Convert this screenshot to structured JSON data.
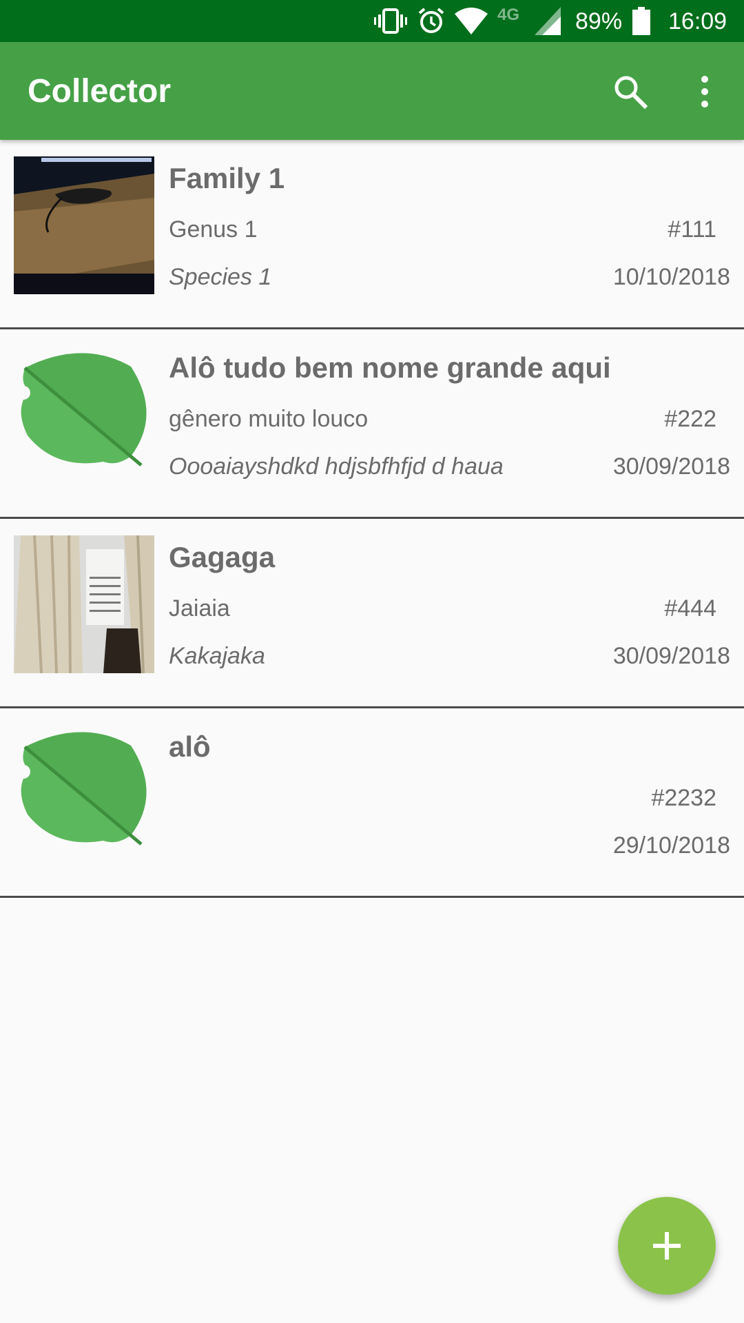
{
  "status_bar": {
    "network_type": "4G",
    "battery_percent": "89%",
    "time": "16:09",
    "icons": [
      "vibrate-icon",
      "alarm-icon",
      "wifi-icon",
      "signal-icon",
      "battery-icon"
    ]
  },
  "app_bar": {
    "title": "Collector",
    "icons": [
      "search-icon",
      "more-vert-icon"
    ]
  },
  "colors": {
    "status_bar": "#006e1b",
    "app_bar": "#46a146",
    "fab": "#8bc34a",
    "leaf": "#5cb85c"
  },
  "items": [
    {
      "thumbnail": "photo",
      "family": "Family 1",
      "genus": "Genus 1",
      "species": "Species 1",
      "number": "#111",
      "date": "10/10/2018"
    },
    {
      "thumbnail": "leaf-icon",
      "family": "Alô tudo bem nome grande aqui",
      "genus": "gênero muito louco",
      "species": "Oooaiayshdkd hdjsbfhfjd d haua",
      "number": "#222",
      "date": "30/09/2018"
    },
    {
      "thumbnail": "photo",
      "family": "Gagaga",
      "genus": "Jaiaia",
      "species": "Kakajaka",
      "number": "#444",
      "date": "30/09/2018"
    },
    {
      "thumbnail": "leaf-icon",
      "family": "alô",
      "genus": "",
      "species": "",
      "number": "#2232",
      "date": "29/10/2018"
    }
  ],
  "fab": {
    "icon": "plus-icon"
  }
}
